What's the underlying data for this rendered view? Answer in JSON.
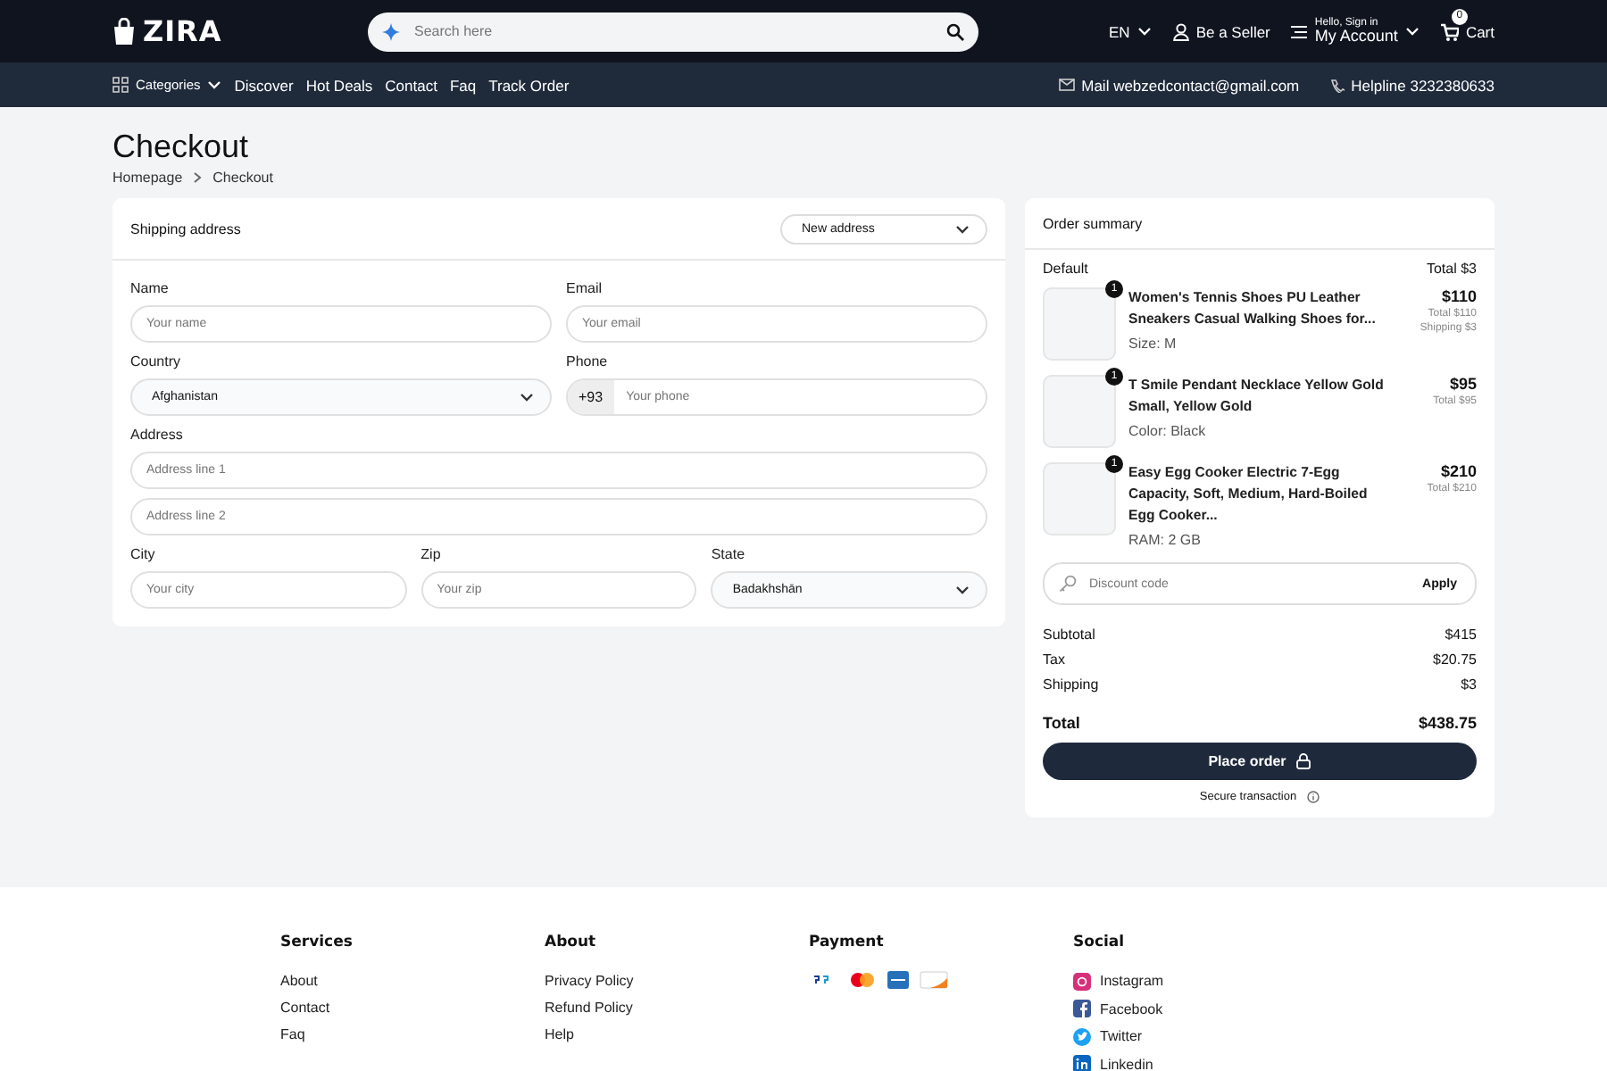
{
  "header": {
    "logo": "ZIRA",
    "search_placeholder": "Search here",
    "language": "EN",
    "seller": "Be a Seller",
    "account_greeting": "Hello, Sign in",
    "account": "My Account",
    "cart_count": "0",
    "cart": "Cart"
  },
  "nav": {
    "categories": "Categories",
    "links": [
      "Discover",
      "Hot Deals",
      "Contact",
      "Faq",
      "Track Order"
    ],
    "mail": "Mail webzedcontact@gmail.com",
    "helpline": "Helpline 3232380633"
  },
  "page": {
    "title": "Checkout",
    "breadcrumbs": [
      "Homepage",
      "Checkout"
    ]
  },
  "shipping": {
    "title": "Shipping address",
    "address_select": "New address",
    "rows": [
      [
        {
          "kind": "text",
          "label": "Name",
          "placeholder": "Your name"
        },
        {
          "kind": "text",
          "label": "Email",
          "placeholder": "Your email"
        }
      ],
      [
        {
          "kind": "select",
          "label": "Country",
          "value": "Afghanistan"
        },
        {
          "kind": "phone",
          "label": "Phone",
          "prefix": "+93",
          "placeholder": "Your phone"
        }
      ],
      [
        {
          "kind": "text",
          "label": "Address",
          "placeholder": "Address line 1"
        }
      ],
      [
        {
          "kind": "text",
          "placeholder": "Address line 2"
        }
      ],
      [
        {
          "kind": "text",
          "label": "City",
          "placeholder": "Your city"
        },
        {
          "kind": "text",
          "label": "Zip",
          "placeholder": "Your zip"
        },
        {
          "kind": "select",
          "label": "State",
          "value": "Badakhshān"
        }
      ]
    ]
  },
  "order": {
    "title": "Order summary",
    "group": "Default",
    "group_total": "Total $3",
    "items": [
      {
        "quantity": "1",
        "name": "Women's Tennis Shoes PU Leather Sneakers Casual Walking Shoes for...",
        "variant": "Size: M",
        "price": "$110",
        "total": "Total $110",
        "shipping": "Shipping $3"
      },
      {
        "quantity": "1",
        "name": "T Smile Pendant Necklace Yellow Gold Small, Yellow Gold",
        "variant": "Color: Black",
        "price": "$95",
        "total": "Total $95"
      },
      {
        "quantity": "1",
        "name": "Easy Egg Cooker Electric 7-Egg Capacity, Soft, Medium, Hard-Boiled Egg Cooker...",
        "variant": "RAM: 2 GB",
        "price": "$210",
        "total": "Total $210"
      }
    ],
    "discount_placeholder": "Discount code",
    "apply": "Apply",
    "lines": [
      {
        "label": "Subtotal",
        "value": "$415"
      },
      {
        "label": "Tax",
        "value": "$20.75"
      },
      {
        "label": "Shipping",
        "value": "$3"
      }
    ],
    "total": {
      "label": "Total",
      "value": "$438.75"
    },
    "place_order": "Place order",
    "secure": "Secure transaction"
  },
  "footer": [
    {
      "kind": "links",
      "title": "Services",
      "links": [
        "About",
        "Contact",
        "Faq"
      ]
    },
    {
      "kind": "links",
      "title": "About",
      "links": [
        "Privacy Policy",
        "Refund Policy",
        "Help"
      ]
    },
    {
      "kind": "payments",
      "title": "Payment"
    },
    {
      "kind": "social",
      "title": "Social",
      "links": [
        "Instagram",
        "Facebook",
        "Twitter",
        "Linkedin"
      ]
    }
  ]
}
